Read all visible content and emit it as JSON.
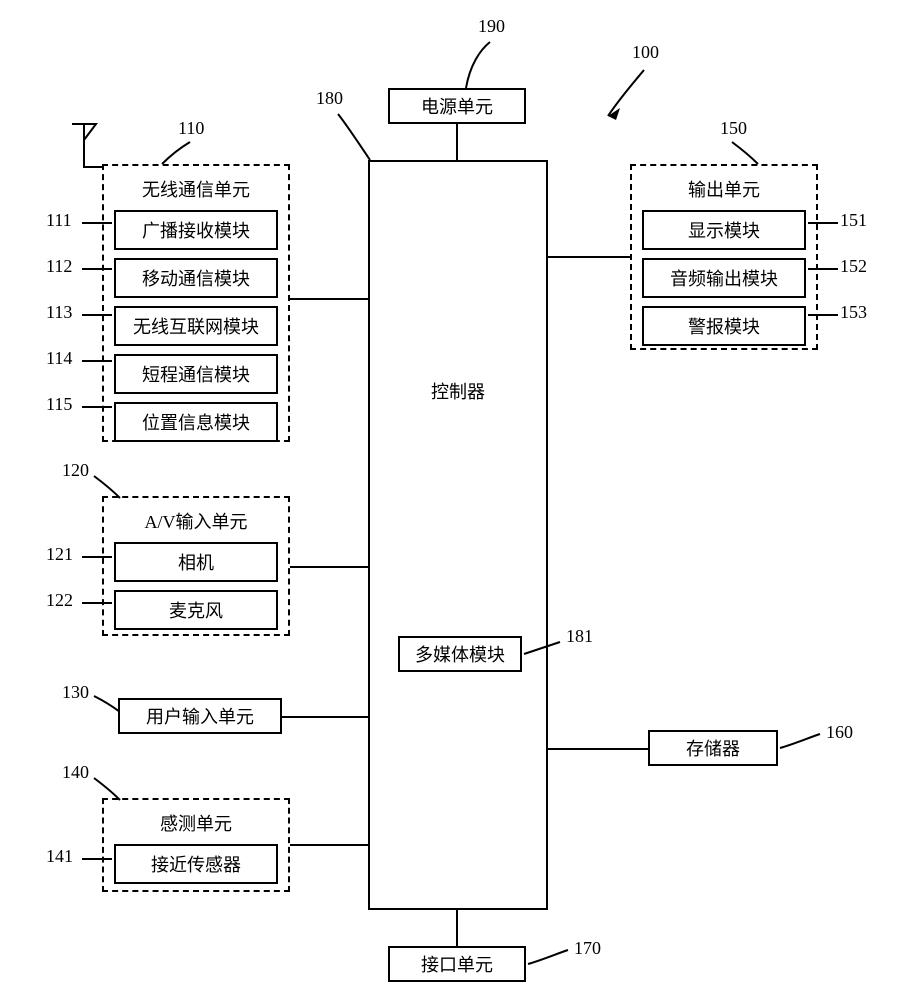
{
  "refs": {
    "r190": "190",
    "r100": "100",
    "r180": "180",
    "r110": "110",
    "r111": "111",
    "r112": "112",
    "r113": "113",
    "r114": "114",
    "r115": "115",
    "r120": "120",
    "r121": "121",
    "r122": "122",
    "r130": "130",
    "r140": "140",
    "r141": "141",
    "r150": "150",
    "r151": "151",
    "r152": "152",
    "r153": "153",
    "r160": "160",
    "r170": "170",
    "r181": "181"
  },
  "power": {
    "label": "电源单元"
  },
  "controller": {
    "label": "控制器"
  },
  "multimedia": {
    "label": "多媒体模块"
  },
  "interface": {
    "label": "接口单元"
  },
  "memory": {
    "label": "存储器"
  },
  "wireless": {
    "title": "无线通信单元",
    "m0": "广播接收模块",
    "m1": "移动通信模块",
    "m2": "无线互联网模块",
    "m3": "短程通信模块",
    "m4": "位置信息模块"
  },
  "av": {
    "title": "A/V输入单元",
    "m0": "相机",
    "m1": "麦克风"
  },
  "userinput": {
    "label": "用户输入单元"
  },
  "sensing": {
    "title": "感测单元",
    "m0": "接近传感器"
  },
  "output": {
    "title": "输出单元",
    "m0": "显示模块",
    "m1": "音频输出模块",
    "m2": "警报模块"
  }
}
